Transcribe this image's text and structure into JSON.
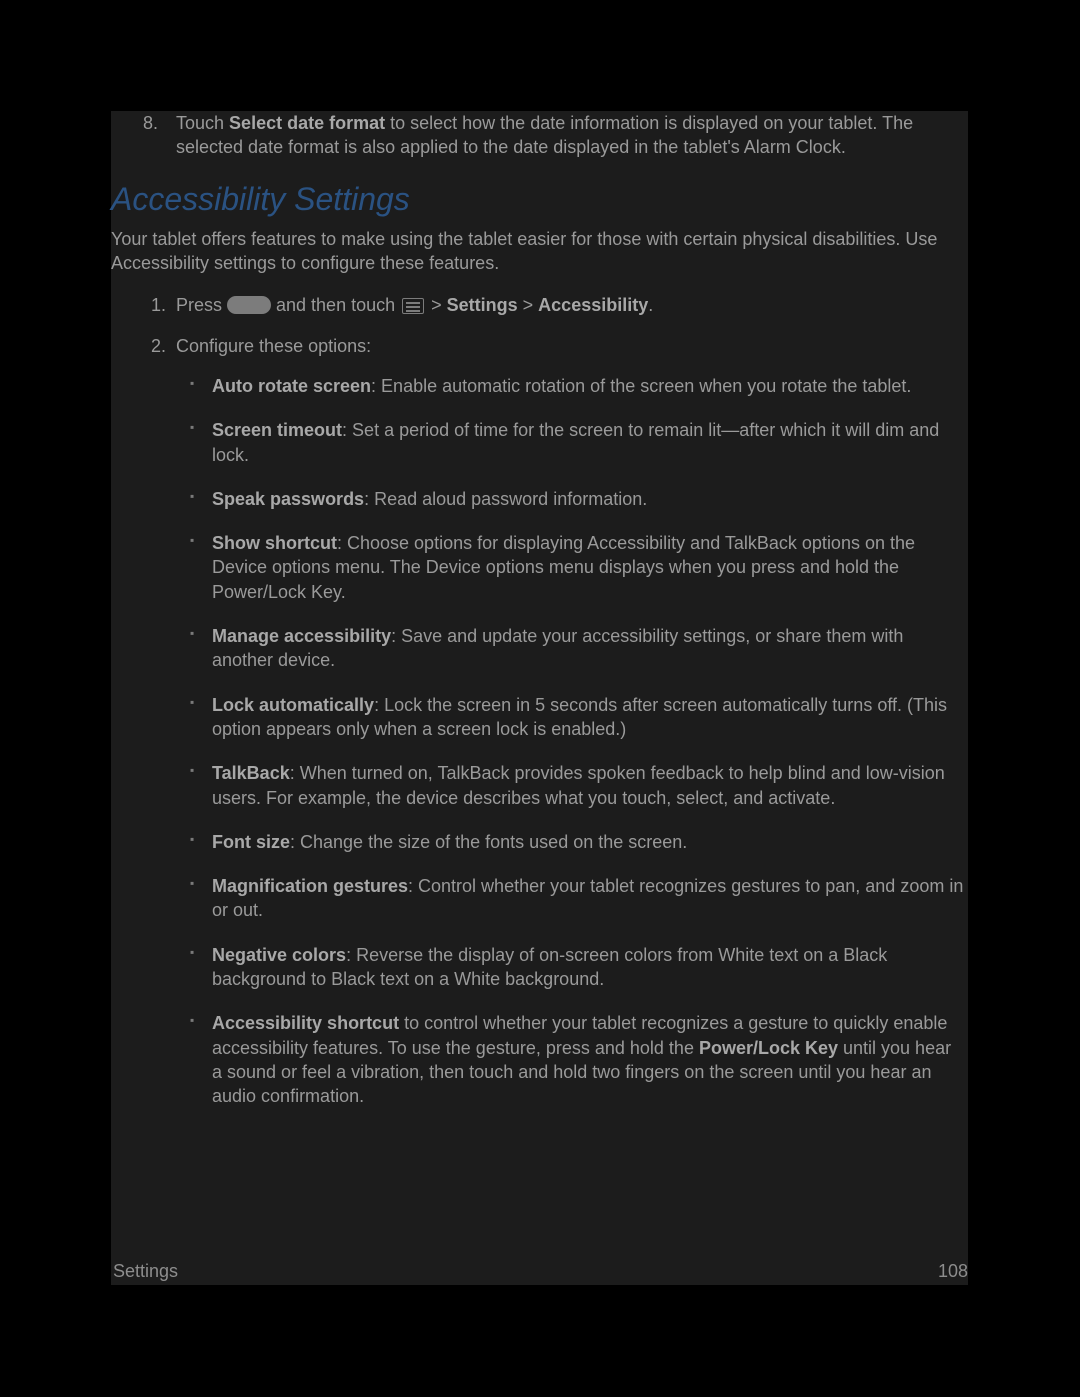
{
  "topItem": {
    "prefix": "Touch ",
    "bold": "Select date format",
    "rest": " to select how the date information is displayed on your tablet. The selected date format is also applied to the date displayed in the tablet's Alarm Clock."
  },
  "heading": "Accessibility Settings",
  "intro": "Your tablet offers features to make using the tablet easier for those with certain physical disabilities. Use Accessibility settings to configure these features.",
  "step1": {
    "p1": "Press ",
    "p2": " and then touch ",
    "p3": " > ",
    "b1": "Settings",
    "p4": " > ",
    "b2": "Accessibility",
    "p5": "."
  },
  "step2_lead": "Configure these options:",
  "bullets": [
    {
      "bold": "Auto rotate screen",
      "text": ": Enable automatic rotation of the screen when you rotate the tablet."
    },
    {
      "bold": "Screen timeout",
      "text": ": Set a period of time for the screen to remain lit—after which it will dim and lock."
    },
    {
      "bold": "Speak passwords",
      "text": ": Read aloud password information."
    },
    {
      "bold": "Show shortcut",
      "text": ": Choose options for displaying Accessibility and TalkBack options on the Device options menu. The Device options menu displays when you press and hold the Power/Lock Key."
    },
    {
      "bold": "Manage accessibility",
      "text": ": Save and update your accessibility settings, or share them with another device."
    },
    {
      "bold": "Lock automatically",
      "text": ": Lock the screen in 5 seconds after screen automatically turns off. (This option appears only when a screen lock is enabled.)"
    },
    {
      "bold": "TalkBack",
      "text": ": When turned on, TalkBack provides spoken feedback to help blind and low-vision users. For example, the device describes what you touch, select, and activate."
    },
    {
      "bold": "Font size",
      "text": ": Change the size of the fonts used on the screen."
    },
    {
      "bold": "Magnification gestures",
      "text": ": Control whether your tablet recognizes gestures to pan, and zoom in or out."
    },
    {
      "bold": "Negative colors",
      "text": ": Reverse the display of on-screen colors from White text on a Black background to Black text on a White background."
    }
  ],
  "lastBullet": {
    "b1": "Accessibility shortcut",
    "t1": " to control whether your tablet recognizes a gesture to quickly enable accessibility features. To use the gesture, press and hold the ",
    "b2": "Power/Lock Key",
    "t2": " until you hear a sound or feel a vibration, then touch and hold two fingers on the screen until you hear an audio confirmation."
  },
  "footer": {
    "left": "Settings",
    "right": "108"
  }
}
